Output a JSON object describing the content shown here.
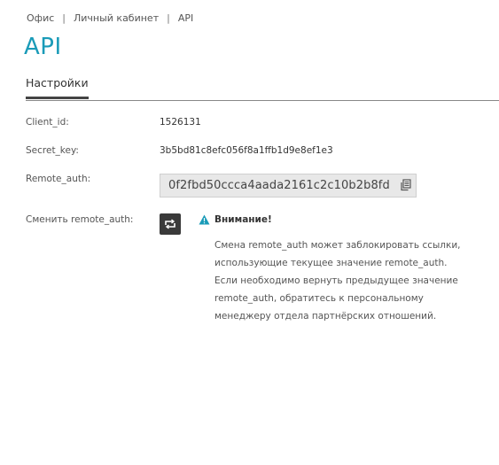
{
  "breadcrumb": {
    "items": [
      "Офис",
      "Личный кабинет",
      "API"
    ],
    "separator": "|"
  },
  "page": {
    "title": "API"
  },
  "tabs": {
    "active": "Настройки"
  },
  "fields": {
    "client_id": {
      "label": "Client_id:",
      "value": "1526131"
    },
    "secret_key": {
      "label": "Secret_key:",
      "value": "3b5bd81c8efc056f8a1ffb1d9e8ef1e3"
    },
    "remote_auth": {
      "label": "Remote_auth:",
      "value": "0f2fbd50ccca4aada2161c2c10b2b8fd"
    },
    "change_remote_auth": {
      "label": "Сменить remote_auth:"
    }
  },
  "warning": {
    "title": "Внимание!",
    "text": "Смена remote_auth может заблокировать ссылки, использующие текущее значение remote_auth. Если необходимо вернуть предыдущее значение remote_auth, обратитесь к персональному менеджеру отдела партнёрских отношений."
  },
  "icons": {
    "copy": "copy-icon",
    "refresh": "refresh-icon",
    "warning": "warning-icon"
  },
  "colors": {
    "title": "#1a9bb8",
    "warning_icon": "#1a9bb8",
    "button_bg": "#3a3a3a",
    "field_bg": "#e8e8e8"
  }
}
